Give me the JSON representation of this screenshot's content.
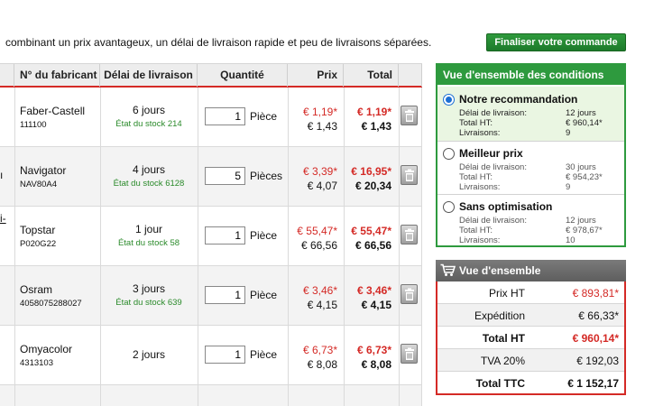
{
  "intro_text": "combinant un prix avantageux, un délai de livraison rapide et peu de livraisons séparées.",
  "finalize_label": "Finaliser votre commande",
  "table": {
    "headers": {
      "maker": "N° du fabricant",
      "delay": "Délai de livraison",
      "qty": "Quantité",
      "price": "Prix",
      "total": "Total"
    },
    "rows": [
      {
        "maker": "Faber-Castell",
        "ref": "111100",
        "delay": "6 jours",
        "stock": "État du stock 214",
        "qty": "1",
        "unit": "Pièce",
        "price_net": "€ 1,19*",
        "price_gross": "€ 1,43",
        "total_net": "€ 1,19*",
        "total_gross": "€ 1,43"
      },
      {
        "maker": "Navigator",
        "ref": "NAV80A4",
        "delay": "4 jours",
        "stock": "État du stock 6128",
        "qty": "5",
        "unit": "Pièces",
        "price_net": "€ 3,39*",
        "price_gross": "€ 4,07",
        "total_net": "€ 16,95*",
        "total_gross": "€ 20,34"
      },
      {
        "maker": "Topstar",
        "ref": "P020G22",
        "delay": "1 jour",
        "stock": "État du stock 58",
        "qty": "1",
        "unit": "Pièce",
        "price_net": "€ 55,47*",
        "price_gross": "€ 66,56",
        "total_net": "€ 55,47*",
        "total_gross": "€ 66,56"
      },
      {
        "maker": "Osram",
        "ref": "4058075288027",
        "delay": "3 jours",
        "stock": "État du stock 639",
        "qty": "1",
        "unit": "Pièce",
        "price_net": "€ 3,46*",
        "price_gross": "€ 4,15",
        "total_net": "€ 3,46*",
        "total_gross": "€ 4,15"
      },
      {
        "maker": "Omyacolor",
        "ref": "4313103",
        "delay": "2 jours",
        "stock": "",
        "qty": "1",
        "unit": "Pièce",
        "price_net": "€ 6,73*",
        "price_gross": "€ 8,08",
        "total_net": "€ 6,73*",
        "total_gross": "€ 8,08"
      }
    ],
    "left_fragments": {
      "row2": "ı",
      "row3": "i-"
    }
  },
  "conditions": {
    "title": "Vue d'ensemble des conditions",
    "options": [
      {
        "title": "Notre recommandation",
        "selected": true,
        "delay_label": "Délai de livraison:",
        "delay": "12 jours",
        "total_label": "Total HT:",
        "total": "€ 960,14*",
        "deliveries_label": "Livraisons:",
        "deliveries": "9"
      },
      {
        "title": "Meilleur prix",
        "selected": false,
        "delay_label": "Délai de livraison:",
        "delay": "30 jours",
        "total_label": "Total HT:",
        "total": "€ 954,23*",
        "deliveries_label": "Livraisons:",
        "deliveries": "9"
      },
      {
        "title": "Sans optimisation",
        "selected": false,
        "delay_label": "Délai de livraison:",
        "delay": "12 jours",
        "total_label": "Total HT:",
        "total": "€ 978,67*",
        "deliveries_label": "Livraisons:",
        "deliveries": "10"
      }
    ]
  },
  "summary": {
    "title": "Vue d'ensemble",
    "rows": [
      {
        "label": "Prix HT",
        "value": "€ 893,81*"
      },
      {
        "label": "Expédition",
        "value": "€ 66,33*"
      },
      {
        "label": "Total HT",
        "value": "€ 960,14*"
      },
      {
        "label": "TVA 20%",
        "value": "€ 192,03"
      },
      {
        "label": "Total TTC",
        "value": "€ 1 152,17"
      }
    ]
  },
  "colors": {
    "accent_red": "#d42a26",
    "accent_green": "#2e9a3e",
    "stock_green": "#2a8a2a"
  },
  "icons": {
    "delete": "trash-icon",
    "cart": "cart-icon"
  }
}
